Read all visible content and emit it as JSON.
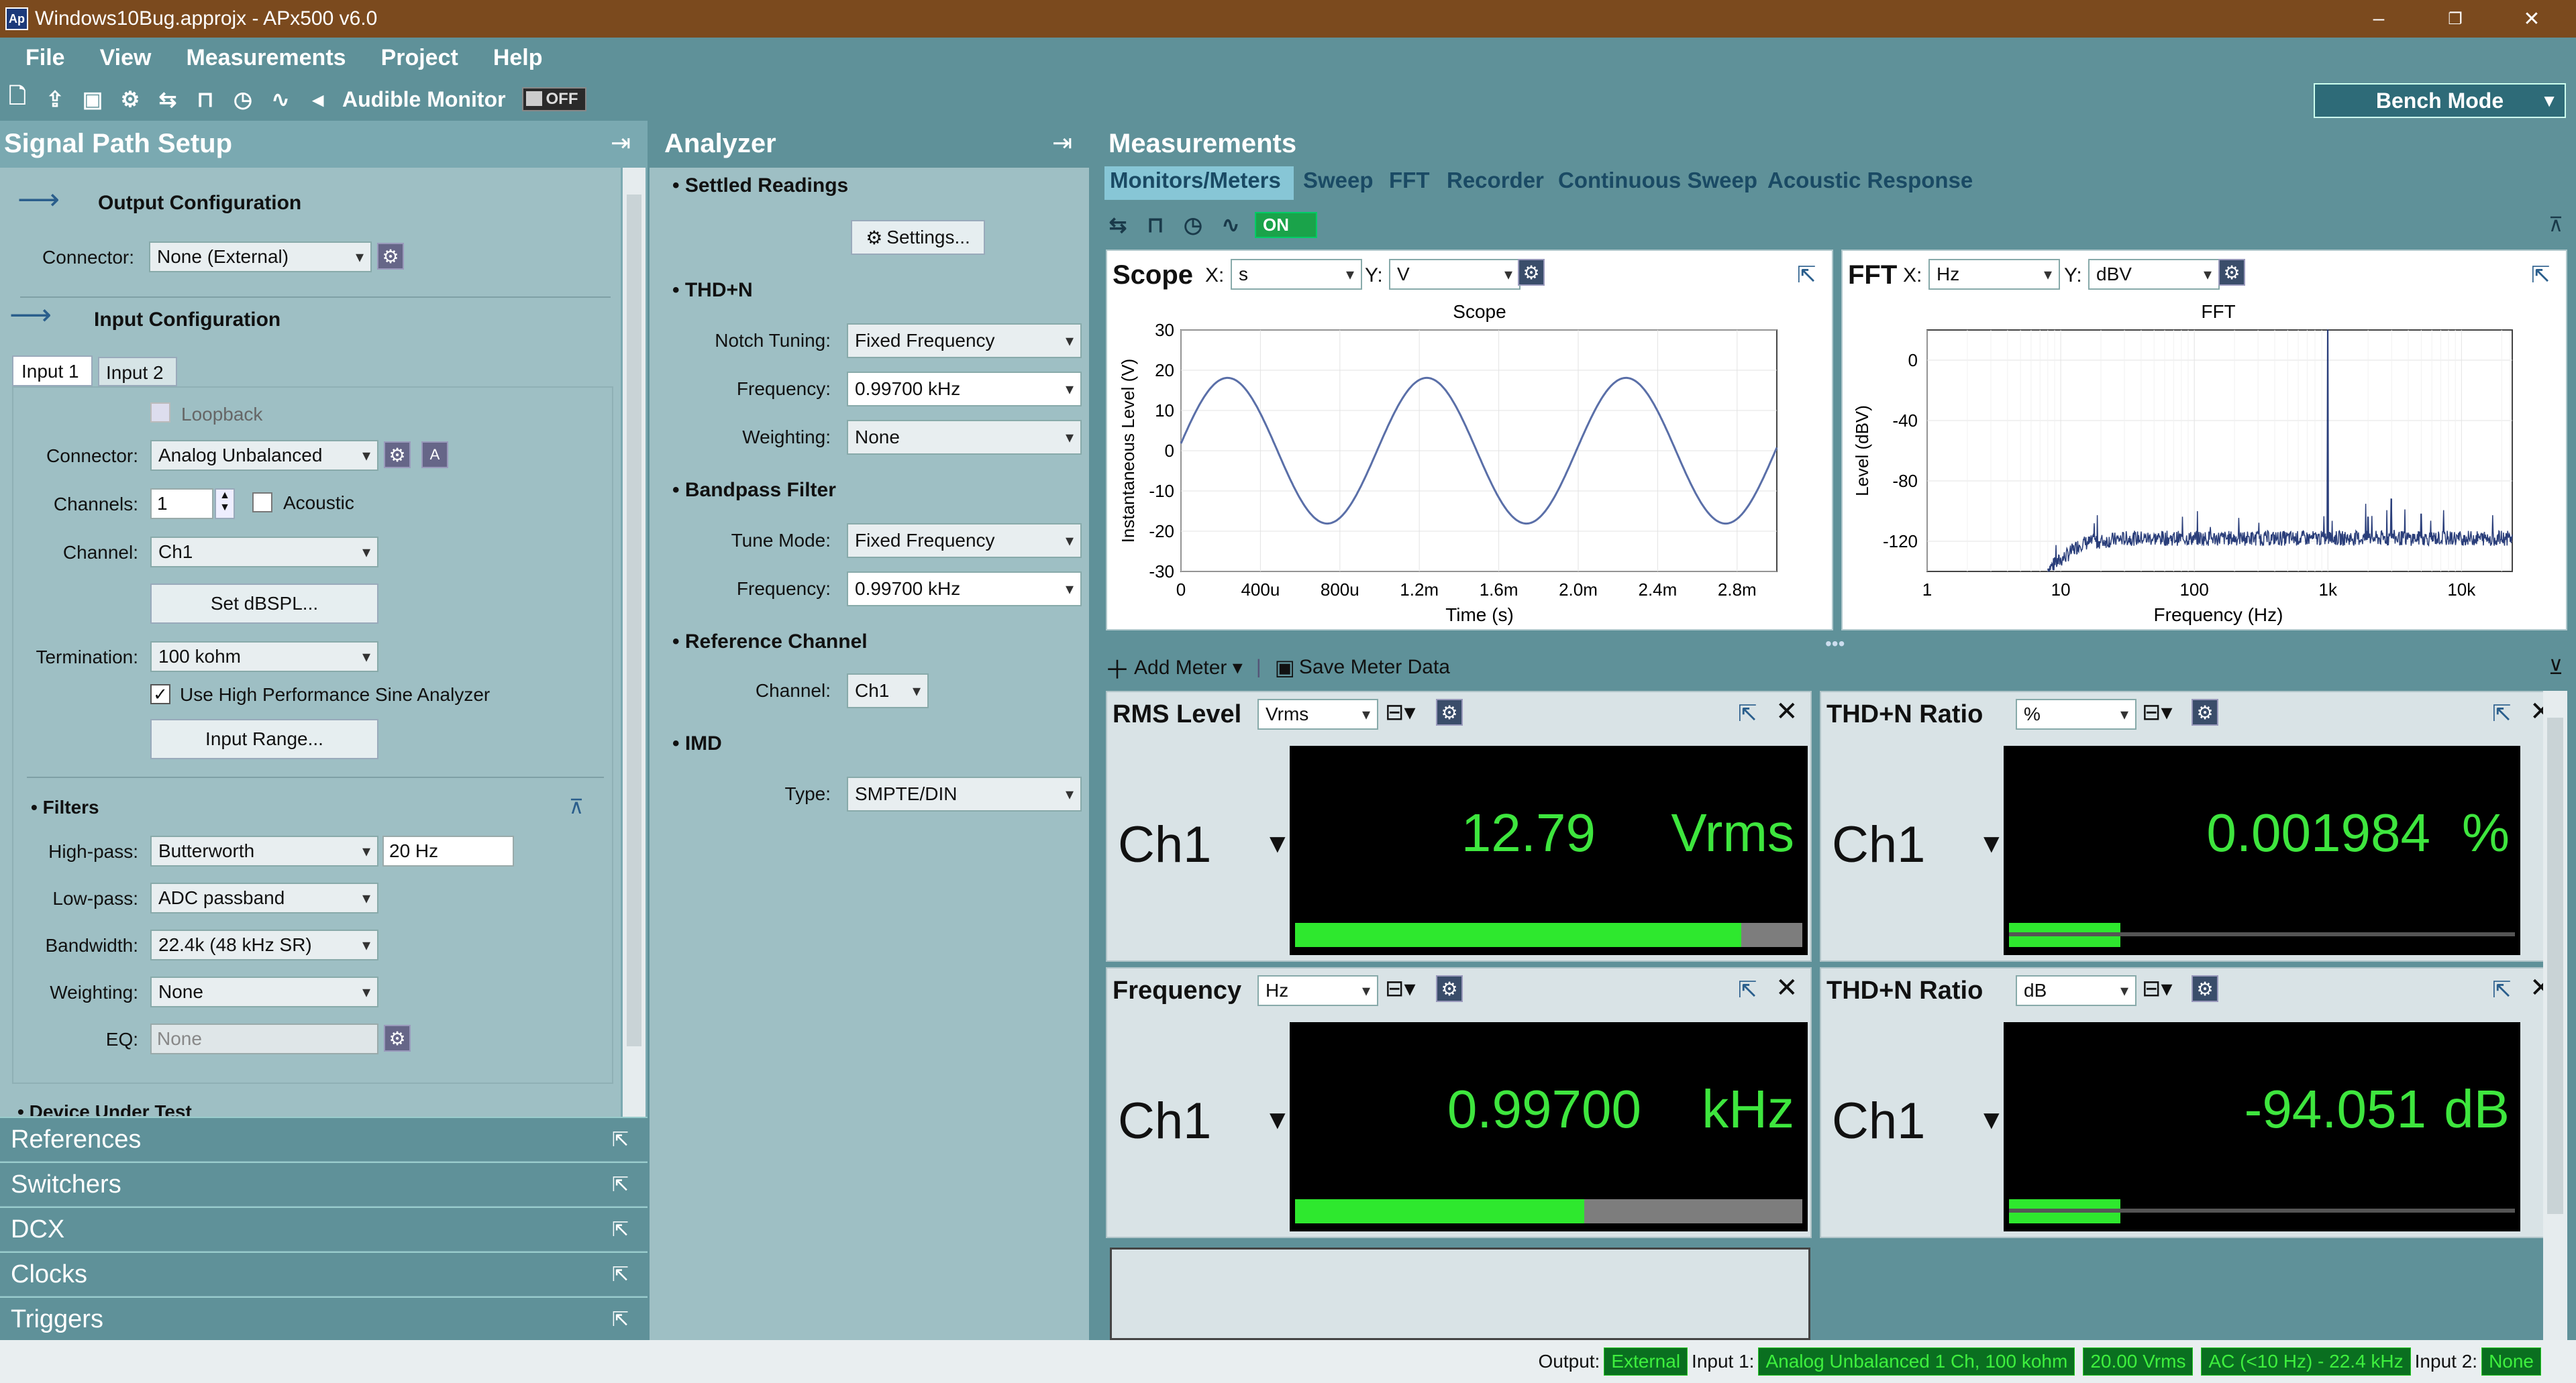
{
  "window": {
    "title": "Windows10Bug.approjx - APx500 v6.0",
    "app_icon": "Ap"
  },
  "menu": [
    "File",
    "View",
    "Measurements",
    "Project",
    "Help"
  ],
  "toolbar": {
    "audible_monitor": "Audible Monitor",
    "toggle": "OFF",
    "bench_mode": "Bench Mode"
  },
  "signal_path": {
    "title": "Signal Path Setup",
    "output_config": "Output Configuration",
    "output_connector_label": "Connector:",
    "output_connector": "None (External)",
    "input_config": "Input Configuration",
    "tabs": [
      "Input 1",
      "Input 2"
    ],
    "loopback": "Loopback",
    "connector_label": "Connector:",
    "connector": "Analog Unbalanced",
    "channels_label": "Channels:",
    "channels": "1",
    "acoustic": "Acoustic",
    "channel_label": "Channel:",
    "channel": "Ch1",
    "set_dbspl": "Set dBSPL...",
    "termination_label": "Termination:",
    "termination": "100 kohm",
    "hp_sine": "Use High Performance Sine Analyzer",
    "input_range": "Input Range...",
    "filters": "Filters",
    "highpass_label": "High-pass:",
    "highpass": "Butterworth",
    "highpass_freq": "20 Hz",
    "lowpass_label": "Low-pass:",
    "lowpass": "ADC passband",
    "bandwidth_label": "Bandwidth:",
    "bandwidth": "22.4k (48 kHz SR)",
    "weighting_label": "Weighting:",
    "weighting": "None",
    "eq_label": "EQ:",
    "eq": "None",
    "device_under_test": "Device Under Test"
  },
  "left_links": [
    "References",
    "Switchers",
    "DCX",
    "Clocks",
    "Triggers"
  ],
  "analyzer": {
    "title": "Analyzer",
    "settled": "Settled Readings",
    "settings": "Settings...",
    "thdn": "THD+N",
    "notch_label": "Notch Tuning:",
    "notch": "Fixed Frequency",
    "freq_label": "Frequency:",
    "freq": "0.99700 kHz",
    "weighting_label": "Weighting:",
    "weighting": "None",
    "bandpass": "Bandpass Filter",
    "tune_label": "Tune Mode:",
    "tune": "Fixed Frequency",
    "bp_freq_label": "Frequency:",
    "bp_freq": "0.99700 kHz",
    "ref_channel": "Reference Channel",
    "channel_label": "Channel:",
    "channel": "Ch1",
    "imd": "IMD",
    "type_label": "Type:",
    "type": "SMPTE/DIN"
  },
  "measurements": {
    "title": "Measurements",
    "tabs": [
      "Monitors/Meters",
      "Sweep",
      "FFT",
      "Recorder",
      "Continuous Sweep",
      "Acoustic Response"
    ],
    "on": "ON",
    "add_meter": "Add Meter",
    "save_meter": "Save Meter Data"
  },
  "scope": {
    "label": "Scope",
    "x_label": "X:",
    "x_unit": "s",
    "y_label": "Y:",
    "y_unit": "V",
    "chart_title": "Scope",
    "xlabel": "Time (s)",
    "ylabel": "Instantaneous Level (V)",
    "yticks": [
      "30",
      "20",
      "10",
      "0",
      "-10",
      "-20",
      "-30"
    ],
    "xticks": [
      "0",
      "400u",
      "800u",
      "1.2m",
      "1.6m",
      "2.0m",
      "2.4m",
      "2.8m"
    ]
  },
  "fft": {
    "label": "FFT",
    "x_label": "X:",
    "x_unit": "Hz",
    "y_label": "Y:",
    "y_unit": "dBV",
    "chart_title": "FFT",
    "xlabel": "Frequency (Hz)",
    "ylabel": "Level (dBV)",
    "yticks": [
      "0",
      "-40",
      "-80",
      "-120"
    ],
    "xticks": [
      "1",
      "10",
      "100",
      "1k",
      "10k"
    ]
  },
  "chart_data": [
    {
      "type": "line",
      "title": "Scope",
      "xlabel": "Time (s)",
      "ylabel": "Instantaneous Level (V)",
      "xlim": [
        0,
        0.003
      ],
      "ylim": [
        -30,
        30
      ],
      "frequency_hz": 997,
      "amplitude_v": 18.1,
      "grid": true
    },
    {
      "type": "line",
      "title": "FFT",
      "xlabel": "Frequency (Hz)",
      "ylabel": "Level (dBV)",
      "xscale": "log",
      "xlim": [
        1,
        24000
      ],
      "ylim": [
        -140,
        20
      ],
      "grid": true,
      "noise_floor_dbv": -118,
      "peaks": [
        {
          "x": 997,
          "y": 22
        },
        {
          "x": 2991,
          "y": -92
        },
        {
          "x": 4985,
          "y": -102
        },
        {
          "x": 2000,
          "y": -104
        }
      ]
    }
  ],
  "meters": [
    {
      "title": "RMS Level",
      "unit_select": "Vrms",
      "channel": "Ch1",
      "value": "12.79",
      "unit": "Vrms",
      "bar": 0.88
    },
    {
      "title": "THD+N Ratio",
      "unit_select": "%",
      "channel": "Ch1",
      "value": "0.001984",
      "unit": "%",
      "bar": 0.22
    },
    {
      "title": "Frequency",
      "unit_select": "Hz",
      "channel": "Ch1",
      "value": "0.99700",
      "unit": "kHz",
      "bar": 0.57
    },
    {
      "title": "THD+N Ratio",
      "unit_select": "dB",
      "channel": "Ch1",
      "value": "-94.051",
      "unit": "dB",
      "bar": 0.22
    }
  ],
  "status": {
    "output_label": "Output:",
    "output": "External",
    "input1_label": "Input 1:",
    "input1": "Analog Unbalanced 1 Ch, 100 kohm",
    "range": "20.00 Vrms",
    "coupling": "AC (<10 Hz) - 22.4 kHz",
    "input2_label": "Input 2:",
    "input2": "None"
  },
  "colors": {
    "accent": "#5f9199",
    "meter_green": "#3ee63e",
    "title_bar": "#7b4a1e",
    "trace": "#5a6fa8"
  }
}
